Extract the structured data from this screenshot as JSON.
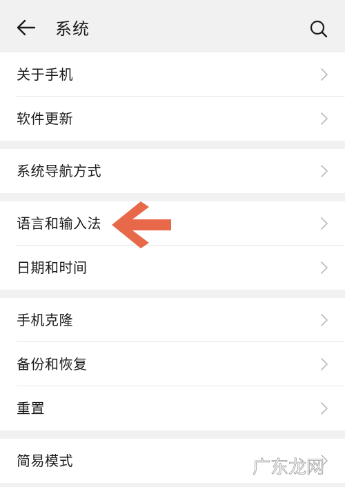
{
  "header": {
    "title": "系统"
  },
  "groups": [
    {
      "items": [
        {
          "label": "关于手机"
        },
        {
          "label": "软件更新"
        }
      ]
    },
    {
      "items": [
        {
          "label": "系统导航方式"
        }
      ]
    },
    {
      "items": [
        {
          "label": "语言和输入法"
        },
        {
          "label": "日期和时间"
        }
      ]
    },
    {
      "items": [
        {
          "label": "手机克隆"
        },
        {
          "label": "备份和恢复"
        },
        {
          "label": "重置"
        }
      ]
    },
    {
      "items": [
        {
          "label": "简易模式"
        }
      ]
    }
  ],
  "annotation": {
    "arrow_color": "#e8694a"
  },
  "watermark": {
    "text": "广东龙网"
  },
  "icons": {
    "back": "back-arrow-icon",
    "search": "search-icon",
    "chevron": "chevron-right-icon"
  },
  "colors": {
    "background": "#f1f1f1",
    "card": "#ffffff",
    "chevron": "#bdbdbd",
    "divider": "#e6e6e6"
  }
}
